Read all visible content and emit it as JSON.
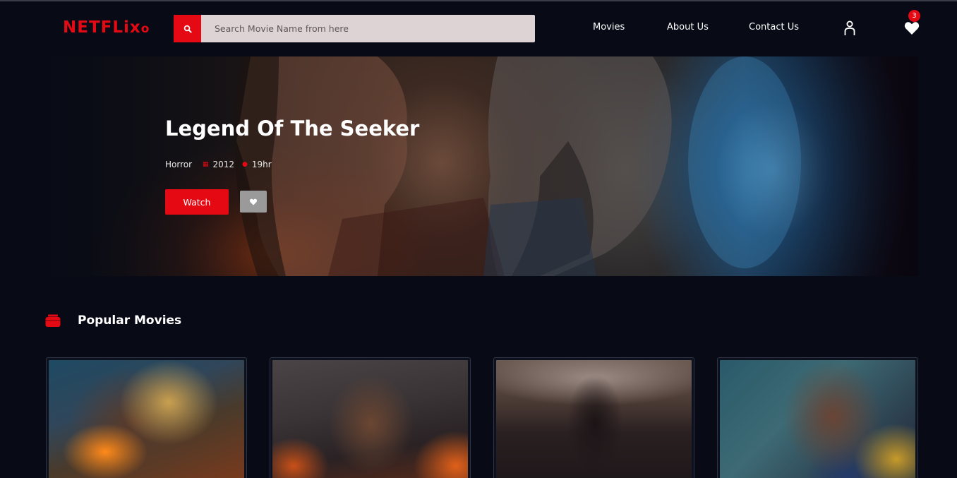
{
  "header": {
    "logo_main": "NETFLix",
    "logo_tail": "o",
    "search_placeholder": "Search Movie Name from here",
    "nav": [
      "Movies",
      "About Us",
      "Contact Us"
    ],
    "wishlist_count": "3"
  },
  "hero": {
    "title": "Legend Of The Seeker",
    "genre": "Horror",
    "year": "2012",
    "duration": "19hr",
    "watch_label": "Watch"
  },
  "section": {
    "title": "Popular Movies"
  },
  "colors": {
    "accent": "#e50914",
    "background": "#080b16"
  },
  "icons": [
    "search-icon",
    "user-icon",
    "heart-icon",
    "calendar-icon",
    "clock-icon",
    "ticket-icon"
  ]
}
